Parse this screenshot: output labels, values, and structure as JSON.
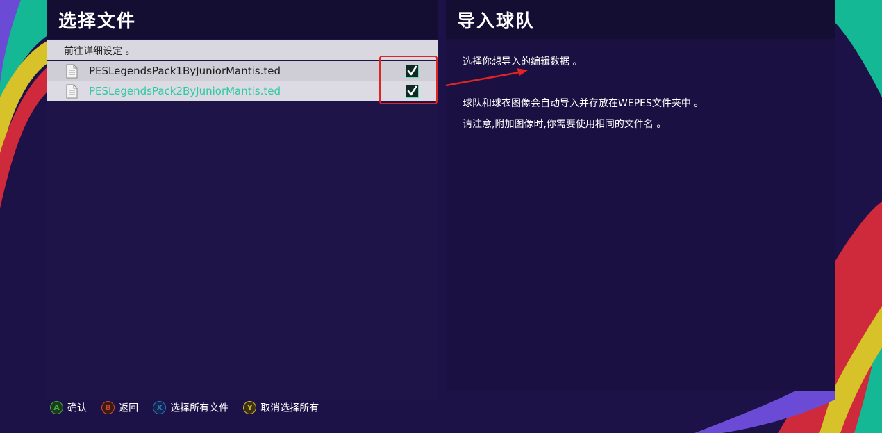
{
  "left_panel": {
    "title": "选择文件",
    "detail_link": "前往详细设定 。",
    "files": [
      {
        "name": "PESLegendsPack1ByJuniorMantis.ted",
        "checked": true
      },
      {
        "name": "PESLegendsPack2ByJuniorMantis.ted",
        "checked": true
      }
    ]
  },
  "right_panel": {
    "title": "导入球队",
    "line1": "选择你想导入的编辑数据 。",
    "line2": "球队和球衣图像会自动导入并存放在WEPES文件夹中 。",
    "line3": "请注意,附加图像时,你需要使用相同的文件名 。"
  },
  "footer": {
    "hints": [
      {
        "button": "A",
        "label": "确认",
        "color": "#3fae3f"
      },
      {
        "button": "B",
        "label": "返回",
        "color": "#d2492a"
      },
      {
        "button": "X",
        "label": "选择所有文件",
        "color": "#2f6fc9"
      },
      {
        "button": "Y",
        "label": "取消选择所有",
        "color": "#d8b32c"
      }
    ]
  },
  "colors": {
    "background": "#1c1248",
    "accent_teal": "#2cc9a2",
    "annotation_red": "#e02424"
  },
  "icons": {
    "file": "document-icon",
    "checkbox": "checkmark-icon"
  }
}
